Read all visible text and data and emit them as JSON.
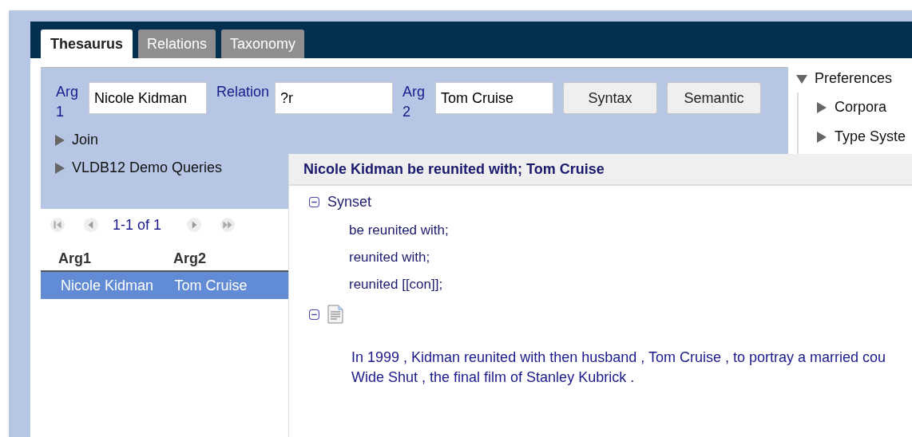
{
  "tabs": [
    {
      "label": "Thesaurus",
      "selected": true
    },
    {
      "label": "Relations",
      "selected": false
    },
    {
      "label": "Taxonomy",
      "selected": false
    }
  ],
  "query": {
    "fields": [
      {
        "label": "Arg 1",
        "value": "Nicole Kidman"
      },
      {
        "label": "Relation",
        "value": "?r"
      },
      {
        "label": "Arg 2",
        "value": "Tom Cruise"
      }
    ],
    "buttons": [
      "Syntax",
      "Semantic"
    ],
    "sections": [
      {
        "label": "Join",
        "expanded": false
      },
      {
        "label": "VLDB12 Demo Queries",
        "expanded": false
      }
    ]
  },
  "results": {
    "pager": "1-1 of 1",
    "columns": [
      "Arg1",
      "Arg2"
    ],
    "rows": [
      {
        "cells": [
          "Nicole Kidman",
          "Tom Cruise"
        ],
        "selected": true
      }
    ]
  },
  "preferences": {
    "label": "Preferences",
    "expanded": true,
    "items": [
      {
        "label": "Corpora",
        "expanded": false
      },
      {
        "label": "Type Syste",
        "expanded": false
      }
    ]
  },
  "popup": {
    "title": "Nicole Kidman be reunited with; Tom Cruise",
    "synset": {
      "label": "Synset",
      "expanded": true,
      "items": [
        "be reunited with;",
        "reunited with;",
        "reunited [[con]];"
      ]
    },
    "document": {
      "expanded": true,
      "lines": [
        "In 1999 , Kidman reunited with then husband , Tom Cruise , to portray a married cou",
        "Wide Shut , the final film of Stanley Kubrick ."
      ]
    }
  }
}
